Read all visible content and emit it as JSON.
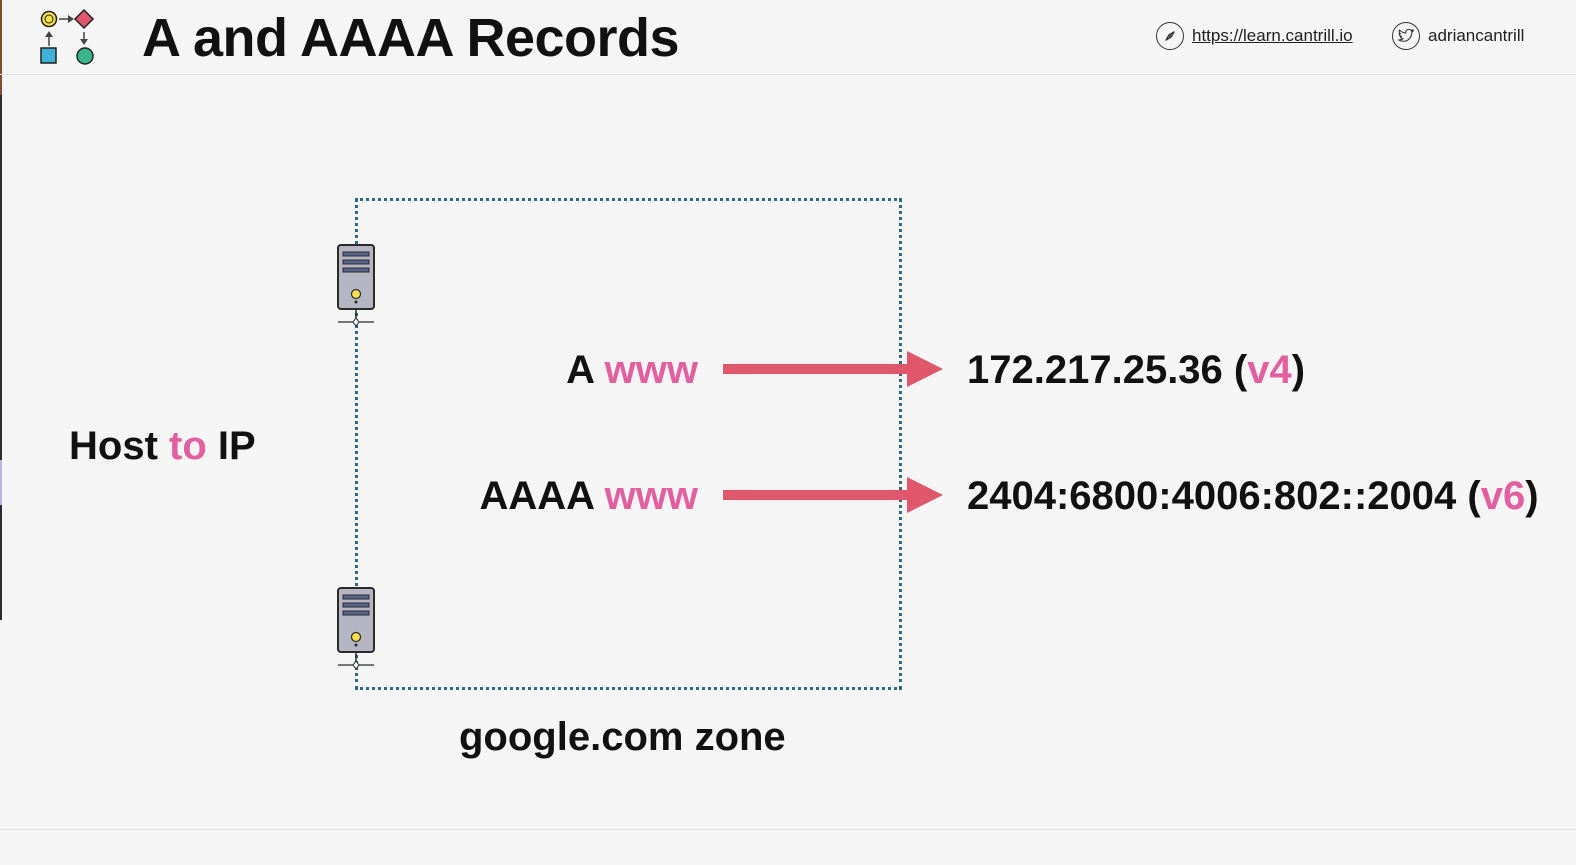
{
  "header": {
    "title": "A and AAAA Records",
    "website": "https://learn.cantrill.io",
    "twitter": "adriancantrill"
  },
  "diagram": {
    "host_label": {
      "part1": "Host ",
      "part2": "to",
      "part3": " IP"
    },
    "records": [
      {
        "type": "A ",
        "name": "www",
        "ip": "172.217.25.36 (",
        "version": "v4",
        "close": ")"
      },
      {
        "type": "AAAA ",
        "name": "www",
        "ip": "2404:6800:4006:802::2004 (",
        "version": "v6",
        "close": ")"
      }
    ],
    "zone_label": "google.com zone"
  },
  "colors": {
    "accent_pink": "#e2609f",
    "arrow": "#e0566b",
    "zone_border": "#2c6b86",
    "background": "#f5f5f5"
  },
  "icons": [
    "workflow-logo-icon",
    "compass-icon",
    "twitter-icon",
    "server-icon"
  ]
}
